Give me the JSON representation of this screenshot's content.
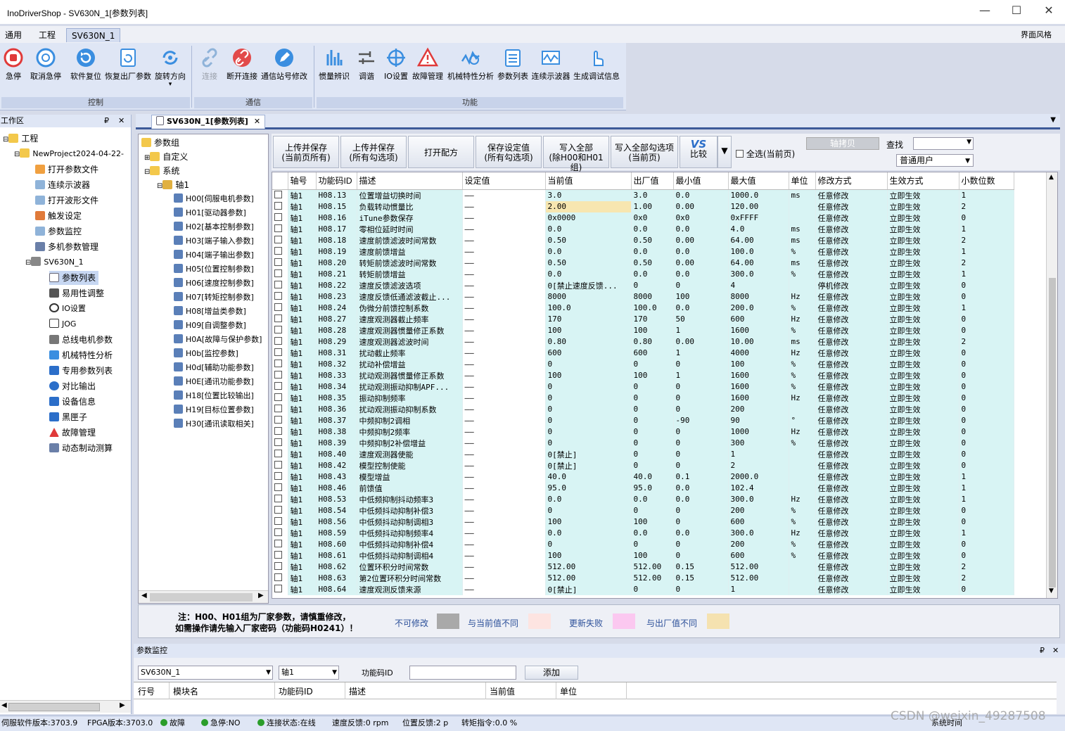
{
  "window": {
    "title": "InoDriverShop - SV630N_1[参数列表]",
    "minimize": "—",
    "maximize": "☐",
    "close": "✕"
  },
  "menu": {
    "tabs": [
      "通用",
      "工程",
      "SV630N_1"
    ],
    "right": "界面风格"
  },
  "ribbon": {
    "buttons": [
      "急停",
      "取消急停",
      "软件复位",
      "恢复出厂参数",
      "旋转方向",
      "连接",
      "断开连接",
      "通信站号修改",
      "惯量辨识",
      "调谐",
      "IO设置",
      "故障管理",
      "机械特性分析",
      "参数列表",
      "连续示波器",
      "生成调试信息"
    ],
    "groups": [
      "控制",
      "通信",
      "功能"
    ]
  },
  "workspace": {
    "header": "工作区",
    "items": [
      "工程",
      "NewProject2024-04-22-",
      "打开参数文件",
      "连续示波器",
      "打开波形文件",
      "触发设定",
      "参数监控",
      "多机参数管理",
      "SV630N_1",
      "参数列表",
      "易用性调整",
      "IO设置",
      "JOG",
      "总线电机参数",
      "机械特性分析",
      "专用参数列表",
      "对比输出",
      "设备信息",
      "黑匣子",
      "故障管理",
      "动态制动测算"
    ]
  },
  "doc_tab": "SV630N_1[参数列表]",
  "param_tree": {
    "nodes": [
      "参数组",
      "自定义",
      "系统",
      "轴1",
      "H00[伺服电机参数]",
      "H01[驱动器参数]",
      "H02[基本控制参数]",
      "H03[端子输入参数]",
      "H04[端子输出参数]",
      "H05[位置控制参数]",
      "H06[速度控制参数]",
      "H07[转矩控制参数]",
      "H08[增益类参数]",
      "H09[自调整参数]",
      "H0A[故障与保护参数]",
      "H0b[监控参数]",
      "H0d[辅助功能参数]",
      "H0E[通讯功能参数]",
      "H18[位置比较输出]",
      "H19[目标位置参数]",
      "H30[通讯读取相关]"
    ]
  },
  "toolbar": {
    "btn1": "上传并保存\n(当前页所有)",
    "btn2": "上传并保存\n(所有勾选项)",
    "btn3": "打开配方",
    "btn4": "保存设定值\n(所有勾选项)",
    "btn5": "写入全部\n(除H00和H01组)",
    "btn6": "写入全部勾选项\n(当前页)",
    "btn7": "比较",
    "select_all": "全选(当前页)",
    "axis_copy": "轴拷贝",
    "search_label": "查找",
    "search_value": "",
    "user_level": "普通用户"
  },
  "table": {
    "columns": [
      "",
      "轴号",
      "功能码ID",
      "描述",
      "设定值",
      "当前值",
      "出厂值",
      "最小值",
      "最大值",
      "单位",
      "修改方式",
      "生效方式",
      "小数位数"
    ],
    "rows": [
      [
        "轴1",
        "H08.13",
        "位置增益切换时间",
        "——",
        "3.0",
        "3.0",
        "0.0",
        "1000.0",
        "ms",
        "任意修改",
        "立即生效",
        "1"
      ],
      [
        "轴1",
        "H08.15",
        "负载转动惯量比",
        "——",
        "2.00",
        "1.00",
        "0.00",
        "120.00",
        "",
        "任意修改",
        "立即生效",
        "2"
      ],
      [
        "轴1",
        "H08.16",
        "iTune参数保存",
        "——",
        "0x0000",
        "0x0",
        "0x0",
        "0xFFFF",
        "",
        "任意修改",
        "立即生效",
        "0"
      ],
      [
        "轴1",
        "H08.17",
        "零相位延时时间",
        "——",
        "0.0",
        "0.0",
        "0.0",
        "4.0",
        "ms",
        "任意修改",
        "立即生效",
        "1"
      ],
      [
        "轴1",
        "H08.18",
        "速度前馈滤波时间常数",
        "——",
        "0.50",
        "0.50",
        "0.00",
        "64.00",
        "ms",
        "任意修改",
        "立即生效",
        "2"
      ],
      [
        "轴1",
        "H08.19",
        "速度前馈增益",
        "——",
        "0.0",
        "0.0",
        "0.0",
        "100.0",
        "%",
        "任意修改",
        "立即生效",
        "1"
      ],
      [
        "轴1",
        "H08.20",
        "转矩前馈滤波时间常数",
        "——",
        "0.50",
        "0.50",
        "0.00",
        "64.00",
        "ms",
        "任意修改",
        "立即生效",
        "2"
      ],
      [
        "轴1",
        "H08.21",
        "转矩前馈增益",
        "——",
        "0.0",
        "0.0",
        "0.0",
        "300.0",
        "%",
        "任意修改",
        "立即生效",
        "1"
      ],
      [
        "轴1",
        "H08.22",
        "速度反馈滤波选项",
        "——",
        "0[禁止速度反馈...",
        "0",
        "0",
        "4",
        "",
        "停机修改",
        "立即生效",
        "0"
      ],
      [
        "轴1",
        "H08.23",
        "速度反馈低通滤波截止...",
        "——",
        "8000",
        "8000",
        "100",
        "8000",
        "Hz",
        "任意修改",
        "立即生效",
        "0"
      ],
      [
        "轴1",
        "H08.24",
        "伪微分前馈控制系数",
        "——",
        "100.0",
        "100.0",
        "0.0",
        "200.0",
        "%",
        "任意修改",
        "立即生效",
        "1"
      ],
      [
        "轴1",
        "H08.27",
        "速度观测器截止频率",
        "——",
        "170",
        "170",
        "50",
        "600",
        "Hz",
        "任意修改",
        "立即生效",
        "0"
      ],
      [
        "轴1",
        "H08.28",
        "速度观测器惯量修正系数",
        "——",
        "100",
        "100",
        "1",
        "1600",
        "%",
        "任意修改",
        "立即生效",
        "0"
      ],
      [
        "轴1",
        "H08.29",
        "速度观测器滤波时间",
        "——",
        "0.80",
        "0.80",
        "0.00",
        "10.00",
        "ms",
        "任意修改",
        "立即生效",
        "2"
      ],
      [
        "轴1",
        "H08.31",
        "扰动截止频率",
        "——",
        "600",
        "600",
        "1",
        "4000",
        "Hz",
        "任意修改",
        "立即生效",
        "0"
      ],
      [
        "轴1",
        "H08.32",
        "扰动补偿增益",
        "——",
        "0",
        "0",
        "0",
        "100",
        "%",
        "任意修改",
        "立即生效",
        "0"
      ],
      [
        "轴1",
        "H08.33",
        "扰动观测器惯量修正系数",
        "——",
        "100",
        "100",
        "1",
        "1600",
        "%",
        "任意修改",
        "立即生效",
        "0"
      ],
      [
        "轴1",
        "H08.34",
        "扰动观测振动抑制APF...",
        "——",
        "0",
        "0",
        "0",
        "1600",
        "%",
        "任意修改",
        "立即生效",
        "0"
      ],
      [
        "轴1",
        "H08.35",
        "振动抑制频率",
        "——",
        "0",
        "0",
        "0",
        "1600",
        "Hz",
        "任意修改",
        "立即生效",
        "0"
      ],
      [
        "轴1",
        "H08.36",
        "扰动观测振动抑制系数",
        "——",
        "0",
        "0",
        "0",
        "200",
        "",
        "任意修改",
        "立即生效",
        "0"
      ],
      [
        "轴1",
        "H08.37",
        "中频抑制2调相",
        "——",
        "0",
        "0",
        "-90",
        "90",
        "°",
        "任意修改",
        "立即生效",
        "0"
      ],
      [
        "轴1",
        "H08.38",
        "中频抑制2频率",
        "——",
        "0",
        "0",
        "0",
        "1000",
        "Hz",
        "任意修改",
        "立即生效",
        "0"
      ],
      [
        "轴1",
        "H08.39",
        "中频抑制2补偿增益",
        "——",
        "0",
        "0",
        "0",
        "300",
        "%",
        "任意修改",
        "立即生效",
        "0"
      ],
      [
        "轴1",
        "H08.40",
        "速度观测器使能",
        "——",
        "0[禁止]",
        "0",
        "0",
        "1",
        "",
        "任意修改",
        "立即生效",
        "0"
      ],
      [
        "轴1",
        "H08.42",
        "模型控制使能",
        "——",
        "0[禁止]",
        "0",
        "0",
        "2",
        "",
        "任意修改",
        "立即生效",
        "0"
      ],
      [
        "轴1",
        "H08.43",
        "模型增益",
        "——",
        "40.0",
        "40.0",
        "0.1",
        "2000.0",
        "",
        "任意修改",
        "立即生效",
        "1"
      ],
      [
        "轴1",
        "H08.46",
        "前馈值",
        "——",
        "95.0",
        "95.0",
        "0.0",
        "102.4",
        "",
        "任意修改",
        "立即生效",
        "1"
      ],
      [
        "轴1",
        "H08.53",
        "中低频抑制抖动频率3",
        "——",
        "0.0",
        "0.0",
        "0.0",
        "300.0",
        "Hz",
        "任意修改",
        "立即生效",
        "1"
      ],
      [
        "轴1",
        "H08.54",
        "中低频抖动抑制补偿3",
        "——",
        "0",
        "0",
        "0",
        "200",
        "%",
        "任意修改",
        "立即生效",
        "0"
      ],
      [
        "轴1",
        "H08.56",
        "中低频抖动抑制调相3",
        "——",
        "100",
        "100",
        "0",
        "600",
        "%",
        "任意修改",
        "立即生效",
        "0"
      ],
      [
        "轴1",
        "H08.59",
        "中低频抖动抑制频率4",
        "——",
        "0.0",
        "0.0",
        "0.0",
        "300.0",
        "Hz",
        "任意修改",
        "立即生效",
        "1"
      ],
      [
        "轴1",
        "H08.60",
        "中低频抖动抑制补偿4",
        "——",
        "0",
        "0",
        "0",
        "200",
        "%",
        "任意修改",
        "立即生效",
        "0"
      ],
      [
        "轴1",
        "H08.61",
        "中低频抖动抑制调相4",
        "——",
        "100",
        "100",
        "0",
        "600",
        "%",
        "任意修改",
        "立即生效",
        "0"
      ],
      [
        "轴1",
        "H08.62",
        "位置环积分时间常数",
        "——",
        "512.00",
        "512.00",
        "0.15",
        "512.00",
        "",
        "任意修改",
        "立即生效",
        "2"
      ],
      [
        "轴1",
        "H08.63",
        "第2位置环积分时间常数",
        "——",
        "512.00",
        "512.00",
        "0.15",
        "512.00",
        "",
        "任意修改",
        "立即生效",
        "2"
      ],
      [
        "轴1",
        "H08.64",
        "速度观测反馈来源",
        "——",
        "0[禁止]",
        "0",
        "0",
        "1",
        "",
        "任意修改",
        "立即生效",
        "0"
      ]
    ]
  },
  "legend": {
    "note1": "注：H00、H01组为厂家参数，请慎重修改，",
    "note2": "如需操作请先输入厂家密码（功能码H0241）！",
    "items": [
      "不可修改",
      "与当前值不同",
      "更新失败",
      "与出厂值不同"
    ],
    "colors": [
      "#a9a9a9",
      "#fde4e1",
      "#fbc8f0",
      "#f5e2b0"
    ]
  },
  "monitor": {
    "header": "参数监控",
    "device": "SV630N_1",
    "axis": "轴1",
    "code_label": "功能码ID",
    "code_value": "",
    "add_button": "添加",
    "columns": [
      "行号",
      "模块名",
      "功能码ID",
      "描述",
      "当前值",
      "单位"
    ]
  },
  "statusbar": {
    "servo_version": "伺服软件版本:3703.9",
    "fpga_version": "FPGA版本:3703.0",
    "fault": "故障",
    "estop": "急停:NO",
    "connection": "连接状态:在线",
    "speed_fb": "速度反馈:0 rpm",
    "pos_fb": "位置反馈:2 p",
    "torque_cmd": "转矩指令:0.0 %",
    "system_time": "系统时间",
    "watermark": "CSDN @weixin_49287508"
  }
}
